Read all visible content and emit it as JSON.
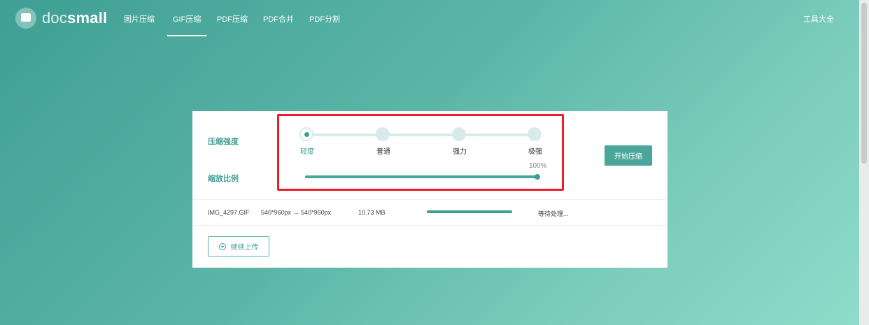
{
  "brand": {
    "prefix": "doc",
    "name": "small"
  },
  "nav": {
    "items": [
      {
        "label": "图片压缩"
      },
      {
        "label": "GIF压缩"
      },
      {
        "label": "PDF压缩"
      },
      {
        "label": "PDF合并"
      },
      {
        "label": "PDF分割"
      }
    ],
    "active": "GIF压缩",
    "right": "工具大全"
  },
  "compress": {
    "strength_label": "压缩强度",
    "levels": [
      "轻度",
      "普通",
      "强力",
      "极强"
    ],
    "selected_level": "轻度",
    "scale_label": "缩放比例",
    "scale_value": "100%",
    "scale_fraction": 1.0,
    "start_button": "开始压缩"
  },
  "file": {
    "name": "IMG_4297.GIF",
    "dimensions": "540*960px → 540*960px",
    "size": "10.73 MB",
    "status": "等待处理..."
  },
  "upload": {
    "label": "继续上传"
  },
  "colors": {
    "accent": "#3f9f94",
    "highlight": "#e8202a"
  }
}
